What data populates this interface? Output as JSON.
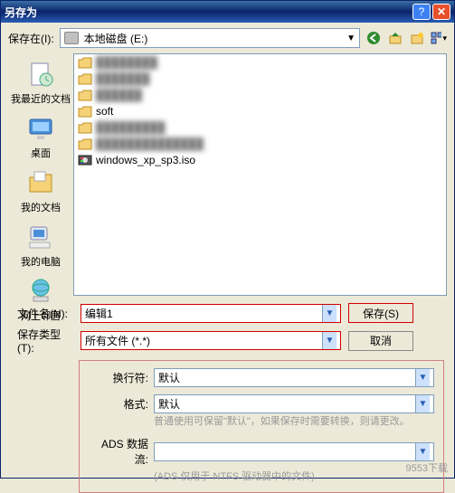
{
  "titlebar": {
    "title": "另存为"
  },
  "toolbar": {
    "save_in_label": "保存在(I):",
    "drive_text": "本地磁盘 (E:)"
  },
  "sidebar": {
    "items": [
      {
        "label": "我最近的文档"
      },
      {
        "label": "桌面"
      },
      {
        "label": "我的文档"
      },
      {
        "label": "我的电脑"
      },
      {
        "label": "网上邻居"
      }
    ]
  },
  "files": {
    "rows": [
      {
        "name": "████████",
        "blur": true,
        "type": "folder"
      },
      {
        "name": "███████",
        "blur": true,
        "type": "folder"
      },
      {
        "name": "██████",
        "blur": true,
        "type": "folder"
      },
      {
        "name": "soft",
        "blur": false,
        "type": "folder"
      },
      {
        "name": "█████████",
        "blur": true,
        "type": "folder"
      },
      {
        "name": "██████████████",
        "blur": true,
        "type": "folder"
      },
      {
        "name": "windows_xp_sp3.iso",
        "blur": false,
        "type": "iso"
      }
    ]
  },
  "form": {
    "filename_label": "文件名(N):",
    "filename_value": "编辑1",
    "filetype_label": "保存类型(T):",
    "filetype_value": "所有文件 (*.*)",
    "linebreak_label": "换行符:",
    "linebreak_value": "默认",
    "format_label": "格式:",
    "format_value": "默认",
    "format_hint": "普通使用可保留\"默认\"，如果保存时需要转换，则请更改。",
    "ads_label": "ADS 数据流:",
    "ads_value": "",
    "ads_hint": "(ADS 仅用于 NTFS 驱动器中的文件)",
    "save_btn": "保存(S)",
    "cancel_btn": "取消"
  },
  "watermark": "9553下载"
}
